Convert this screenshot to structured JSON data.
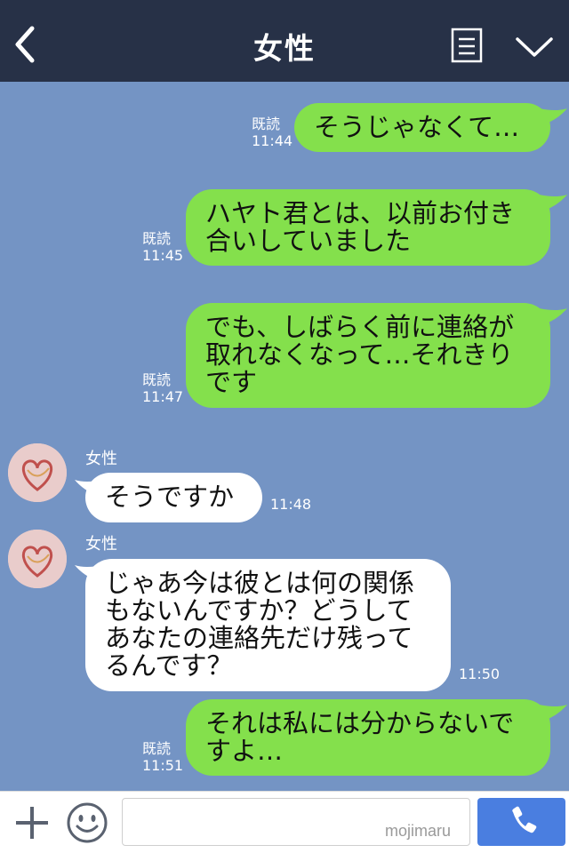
{
  "header": {
    "title": "女性",
    "back_icon": "chevron-left-icon",
    "menu_icon": "notes-icon",
    "collapse_icon": "chevron-down-icon"
  },
  "messages": [
    {
      "direction": "out",
      "text": "そうじゃなくて…",
      "read_label": "既読",
      "time": "11:44"
    },
    {
      "direction": "out",
      "text": "ハヤト君とは、以前お付き\n合いしていました",
      "read_label": "既読",
      "time": "11:45"
    },
    {
      "direction": "out",
      "text": "でも、しばらく前に連絡が\n取れなくなって…それきり\nです",
      "read_label": "既読",
      "time": "11:47"
    },
    {
      "direction": "in",
      "sender": "女性",
      "text": "そうですか",
      "time": "11:48"
    },
    {
      "direction": "in",
      "sender": "女性",
      "text": "じゃあ今は彼とは何の関係\nもないんですか？どうして\nあなたの連絡先だけ残って\nるんです？",
      "time": "11:50"
    },
    {
      "direction": "out",
      "text": "それは私には分からないで\nすよ…",
      "read_label": "既読",
      "time": "11:51"
    }
  ],
  "footer": {
    "plus_icon": "plus-icon",
    "emoji_icon": "smiley-icon",
    "input_value": "",
    "call_icon": "phone-icon",
    "watermark": "mojimaru"
  },
  "colors": {
    "header_bg": "#273147",
    "chat_bg": "#7494c4",
    "outgoing_bubble": "#84e04c",
    "incoming_bubble": "#ffffff",
    "call_button": "#4a7ee0"
  }
}
